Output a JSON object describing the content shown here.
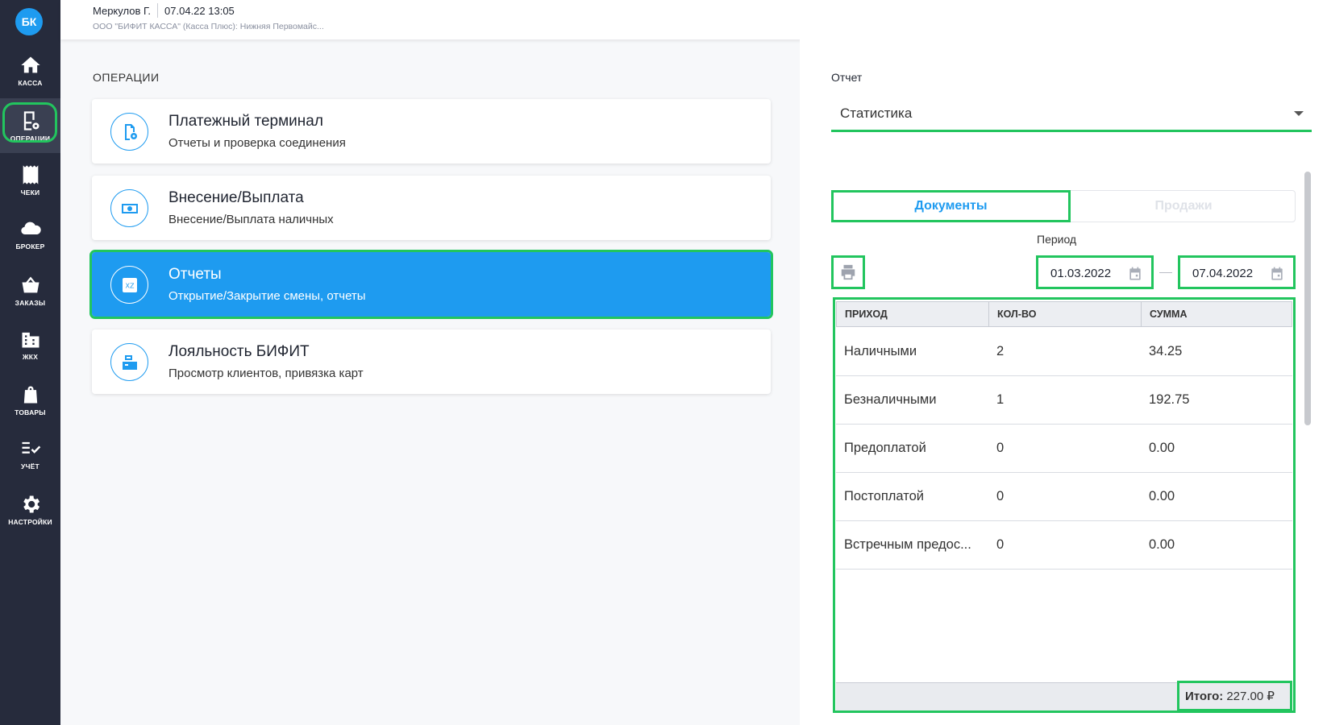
{
  "sidebar": {
    "avatar": "БК",
    "items": [
      {
        "label": "КАССА",
        "icon": "home-icon"
      },
      {
        "label": "ОПЕРАЦИИ",
        "icon": "operations-icon"
      },
      {
        "label": "ЧЕКИ",
        "icon": "receipt-icon"
      },
      {
        "label": "БРОКЕР",
        "icon": "cloud-icon"
      },
      {
        "label": "ЗАКАЗЫ",
        "icon": "basket-icon"
      },
      {
        "label": "ЖКХ",
        "icon": "building-icon"
      },
      {
        "label": "ТОВАРЫ",
        "icon": "bag-icon"
      },
      {
        "label": "УЧЁТ",
        "icon": "checklist-icon"
      },
      {
        "label": "НАСТРОЙКИ",
        "icon": "gear-icon"
      }
    ],
    "active_item": "ОПЕРАЦИИ"
  },
  "topbar": {
    "user": "Меркулов Г.",
    "datetime": "07.04.22 13:05",
    "organization": "ООО \"БИФИТ КАССА\" (Касса Плюс): Нижняя Первомайс..."
  },
  "operations": {
    "title": "ОПЕРАЦИИ",
    "items": [
      {
        "title": "Платежный терминал",
        "subtitle": "Отчеты и проверка соединения",
        "icon": "terminal-icon"
      },
      {
        "title": "Внесение/Выплата",
        "subtitle": "Внесение/Выплата наличных",
        "icon": "cash-icon"
      },
      {
        "title": "Отчеты",
        "subtitle": "Открытие/Закрытие смены, отчеты",
        "icon": "xz-report-icon",
        "selected": true
      },
      {
        "title": "Лояльность БИФИТ",
        "subtitle": "Просмотр клиентов, привязка карт",
        "icon": "loyalty-icon"
      }
    ],
    "xz_text": "XZ"
  },
  "report": {
    "label": "Отчет",
    "selected": "Статистика",
    "tabs": [
      {
        "label": "Документы",
        "active": true
      },
      {
        "label": "Продажи",
        "active": false
      }
    ],
    "period_label": "Период",
    "date_from": "01.03.2022",
    "date_to": "07.04.2022",
    "table": {
      "headers": [
        "ПРИХОД",
        "КОЛ-ВО",
        "СУММА"
      ],
      "rows": [
        [
          "Наличными",
          "2",
          "34.25"
        ],
        [
          "Безналичными",
          "1",
          "192.75"
        ],
        [
          "Предоплатой",
          "0",
          "0.00"
        ],
        [
          "Постоплатой",
          "0",
          "0.00"
        ],
        [
          "Встречным предос...",
          "0",
          "0.00"
        ]
      ],
      "total_label": "Итого:",
      "total_value": "227.00 ₽"
    }
  },
  "colors": {
    "sidebar_bg": "#262b3c",
    "accent": "#1e9bf0",
    "highlight": "#22c55e"
  }
}
